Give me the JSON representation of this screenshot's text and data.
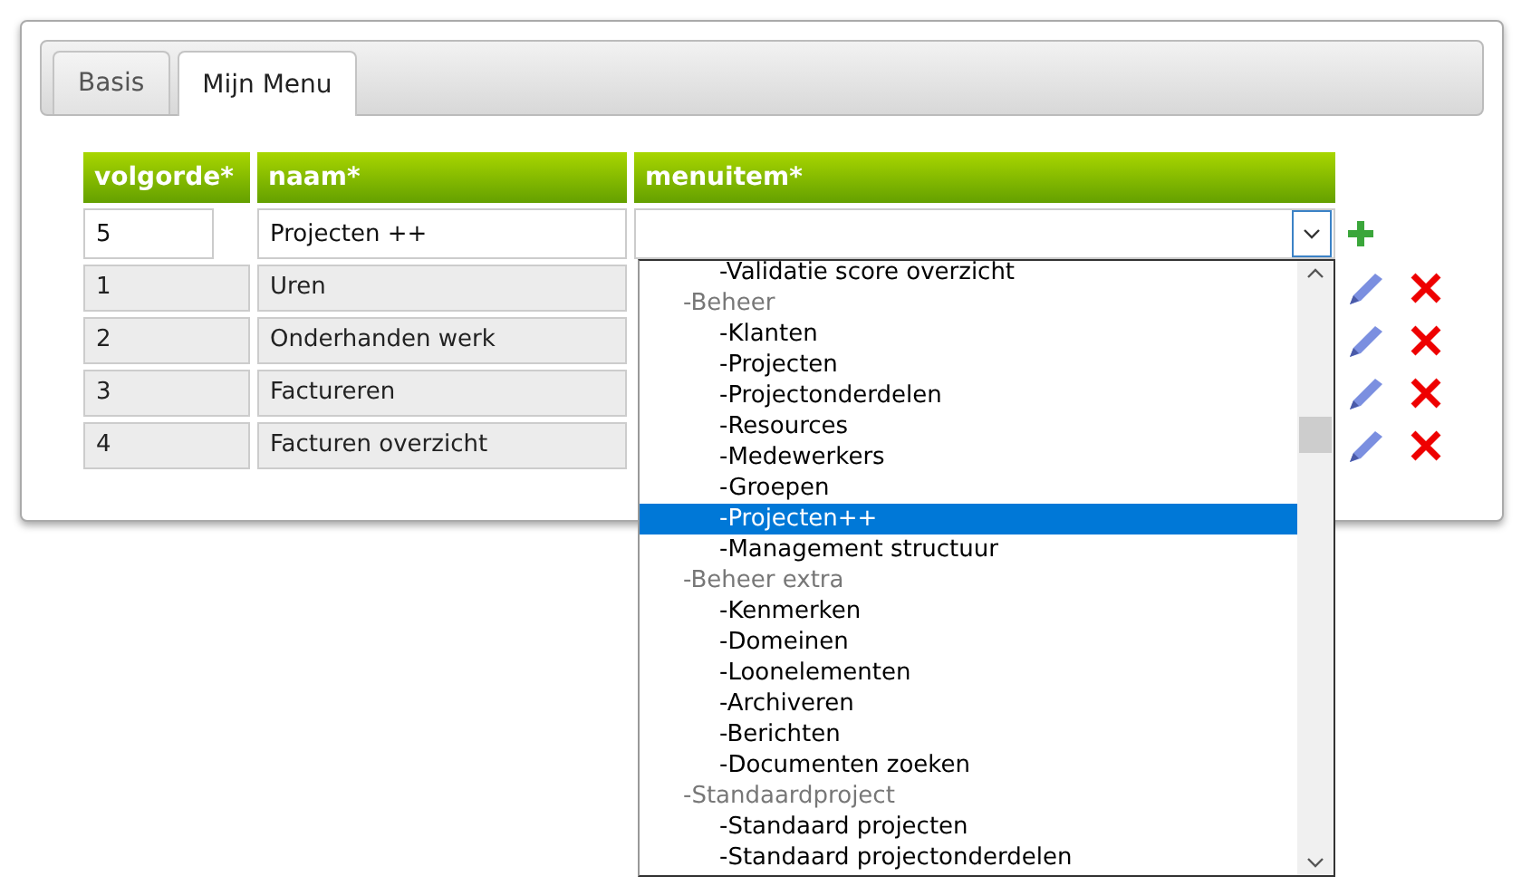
{
  "tabs": [
    {
      "label": "Basis",
      "selected": false
    },
    {
      "label": "Mijn Menu",
      "selected": true
    }
  ],
  "table": {
    "columns": [
      "volgorde*",
      "naam*",
      "menuitem*"
    ],
    "new_row": {
      "volgorde": "5",
      "naam": "Projecten ++"
    },
    "rows": [
      {
        "volgorde": "1",
        "naam": "Uren"
      },
      {
        "volgorde": "2",
        "naam": "Onderhanden werk"
      },
      {
        "volgorde": "3",
        "naam": "Factureren"
      },
      {
        "volgorde": "4",
        "naam": "Facturen overzicht"
      }
    ]
  },
  "dropdown": {
    "options": [
      {
        "kind": "item",
        "label": "-Validatie score overzicht",
        "selected": false
      },
      {
        "kind": "group",
        "label": "-Beheer",
        "children": [
          {
            "label": "-Klanten",
            "selected": false
          },
          {
            "label": "-Projecten",
            "selected": false
          },
          {
            "label": "-Projectonderdelen",
            "selected": false
          },
          {
            "label": "-Resources",
            "selected": false
          },
          {
            "label": "-Medewerkers",
            "selected": false
          },
          {
            "label": "-Groepen",
            "selected": false
          },
          {
            "label": "-Projecten++",
            "selected": true
          },
          {
            "label": "-Management structuur",
            "selected": false
          }
        ]
      },
      {
        "kind": "group",
        "label": "-Beheer extra",
        "children": [
          {
            "label": "-Kenmerken",
            "selected": false
          },
          {
            "label": "-Domeinen",
            "selected": false
          },
          {
            "label": "-Loonelementen",
            "selected": false
          },
          {
            "label": "-Archiveren",
            "selected": false
          },
          {
            "label": "-Berichten",
            "selected": false
          },
          {
            "label": "-Documenten zoeken",
            "selected": false
          }
        ]
      },
      {
        "kind": "group",
        "label": "-Standaardproject",
        "children": [
          {
            "label": "-Standaard projecten",
            "selected": false
          },
          {
            "label": "-Standaard projectonderdelen",
            "selected": false
          }
        ]
      }
    ]
  }
}
